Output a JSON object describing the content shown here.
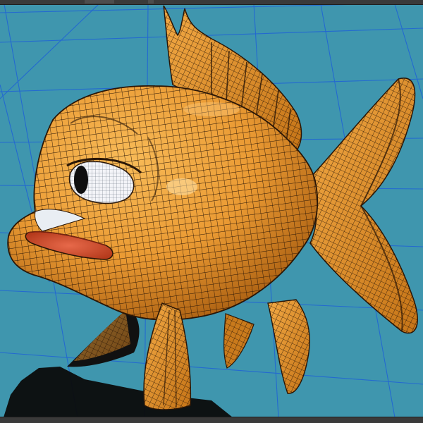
{
  "viewport": {
    "background": "#3f96ae",
    "grid_color": "#1f62d6",
    "shadow_color": "#0b0b0b"
  },
  "model": {
    "name": "goldfish",
    "body_color": "#ea9a33",
    "body_highlight": "#f6b04d",
    "body_shadow": "#b46812",
    "wire_color": "#2a1606",
    "eye_color": "#f3f4f8",
    "lip_color": "#d8552e"
  },
  "icons": {
    "viewport": "3d-viewport"
  }
}
